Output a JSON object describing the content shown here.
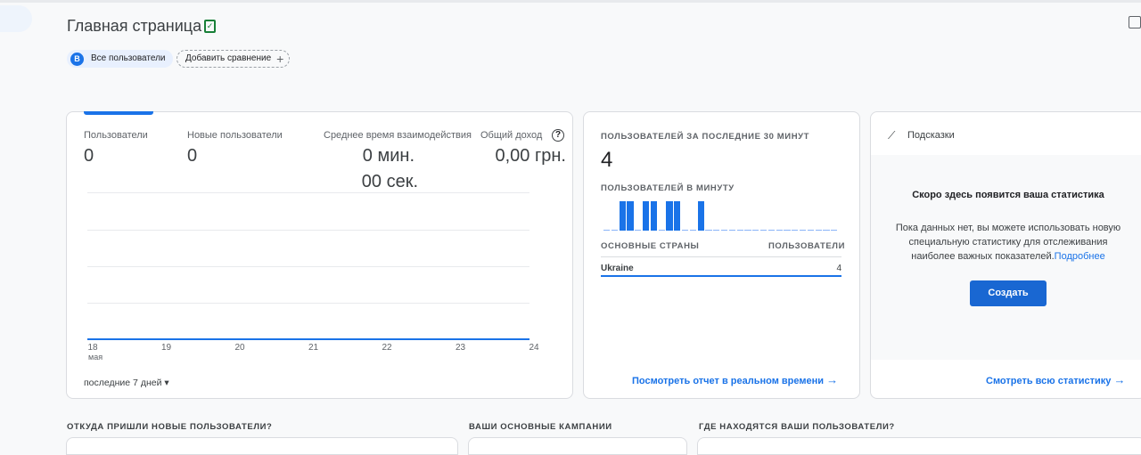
{
  "header": {
    "title": "Главная страница",
    "segment_badge": "B",
    "segment": "Все пользователи",
    "add_compare": "Добавить сравнение",
    "add_icon": "+"
  },
  "overview": {
    "metrics": [
      {
        "label": "Пользователи",
        "value": "0"
      },
      {
        "label": "Новые пользователи",
        "value": "0"
      },
      {
        "label": "Среднее время взаимодействия",
        "value": "0 мин.",
        "value2": "00 сек."
      },
      {
        "label": "Общий доход",
        "value": "0,00 грн."
      }
    ],
    "x_ticks": [
      "18",
      "19",
      "20",
      "21",
      "22",
      "23",
      "24"
    ],
    "x_sub": "мая",
    "date_range": "последние 7 дней"
  },
  "realtime": {
    "title": "ПОЛЬЗОВАТЕЛЕЙ ЗА ПОСЛЕДНИЕ 30 МИНУТ",
    "value": "4",
    "per_minute_label": "ПОЛЬЗОВАТЕЛЕЙ В МИНУТУ",
    "per_minute": [
      0,
      0,
      1,
      1,
      0,
      1,
      1,
      0,
      1,
      1,
      0,
      0,
      1,
      0,
      0,
      0,
      0,
      0,
      0,
      0,
      0,
      0,
      0,
      0,
      0,
      0,
      0,
      0,
      0,
      0
    ],
    "col_country": "ОСНОВНЫЕ СТРАНЫ",
    "col_users": "ПОЛЬЗОВАТЕЛИ",
    "rows": [
      {
        "country": "Ukraine",
        "users": "4"
      }
    ],
    "link": "Посмотреть отчет в реальном времени"
  },
  "insights": {
    "title": "Подсказки",
    "heading": "Скоро здесь появится ваша статистика",
    "body": "Пока данных нет, вы можете использовать новую специальную статистику для отслеживания наиболее важных показателей.",
    "more": "Подробнее",
    "create": "Создать",
    "link": "Смотреть всю статистику"
  },
  "sections": [
    "ОТКУДА ПРИШЛИ НОВЫЕ ПОЛЬЗОВАТЕЛИ?",
    "ВАШИ ОСНОВНЫЕ КАМПАНИИ",
    "ГДЕ НАХОДЯТСЯ ВАШИ ПОЛЬЗОВАТЕЛИ?"
  ],
  "colors": {
    "accent": "#1a73e8",
    "button": "#1967d2"
  }
}
